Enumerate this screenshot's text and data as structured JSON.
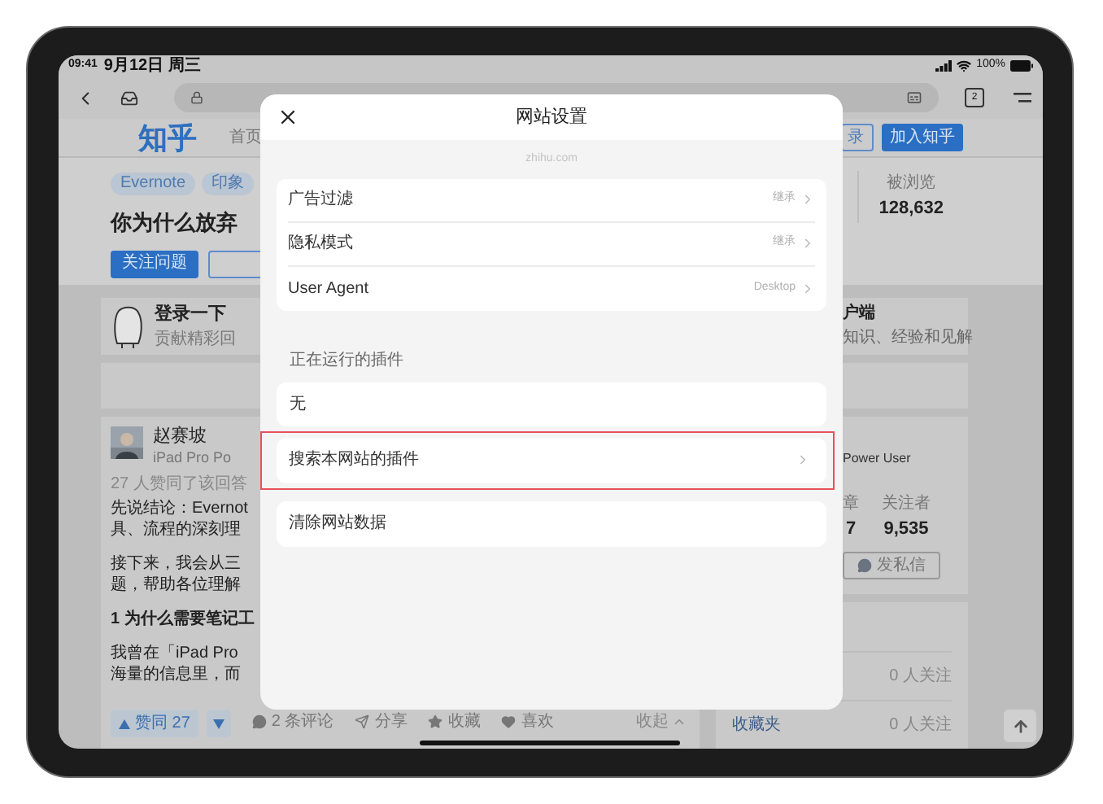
{
  "status_bar": {
    "time": "09:41",
    "date": "9月12日 周三",
    "battery": "100%"
  },
  "browser_toolbar": {
    "tab_count": "2"
  },
  "site_header": {
    "logo": "知乎",
    "nav": [
      "首页"
    ],
    "buttons": [
      {
        "label": "录",
        "kind": "outline"
      },
      {
        "label": "加入知乎",
        "kind": "primary"
      }
    ]
  },
  "question": {
    "tags": [
      "Evernote",
      "印象"
    ],
    "title": "你为什么放弃",
    "follow_button": "关注问题",
    "stats": [
      {
        "label": "被浏览",
        "value": "128,632"
      }
    ]
  },
  "login_card": {
    "title": "登录一下",
    "subtitle": "贡献精彩回"
  },
  "app_card": {
    "title": "户端",
    "subtitle": "知识、经验和见解"
  },
  "answer": {
    "author": "赵赛坡",
    "author_bio": "iPad Pro Po",
    "votes_text": "27 人赞同了该回答",
    "paragraphs": [
      {
        "kind": "body",
        "lines": [
          "先说结论：Evernot",
          "具、流程的深刻理"
        ]
      },
      {
        "kind": "body",
        "lines": [
          "接下来，我会从三",
          "题，帮助各位理解"
        ]
      },
      {
        "kind": "heading",
        "lines": [
          "1 为什么需要笔记工"
        ]
      },
      {
        "kind": "body",
        "lines": [
          "我曾在「iPad Pro",
          "海量的信息里，而"
        ]
      }
    ],
    "upvote": "赞同 27",
    "comments": "2 条评论",
    "share": "分享",
    "collect": "收藏",
    "like": "喜欢",
    "collapse": "收起"
  },
  "author_card": {
    "bio": "Power User",
    "stats": [
      {
        "label": "章",
        "value": "7"
      },
      {
        "label": "关注者",
        "value": "9,535"
      }
    ],
    "message_button": "发私信"
  },
  "side_list": [
    {
      "count": "0 人关注"
    },
    {
      "title": "收藏夹",
      "count": "0 人关注"
    }
  ],
  "site_settings": {
    "title": "网站设置",
    "domain": "zhihu.com",
    "settings": [
      {
        "label": "广告过滤",
        "value": "继承"
      },
      {
        "label": "隐私模式",
        "value": "继承"
      },
      {
        "label": "User Agent",
        "value": "Desktop"
      }
    ],
    "plugins_heading": "正在运行的插件",
    "running_plugins": [
      "无"
    ],
    "actions": [
      {
        "label": "搜索本网站的插件",
        "kind": "link",
        "highlighted": true
      },
      {
        "label": "清除网站数据",
        "kind": "action",
        "highlighted": false
      }
    ]
  }
}
